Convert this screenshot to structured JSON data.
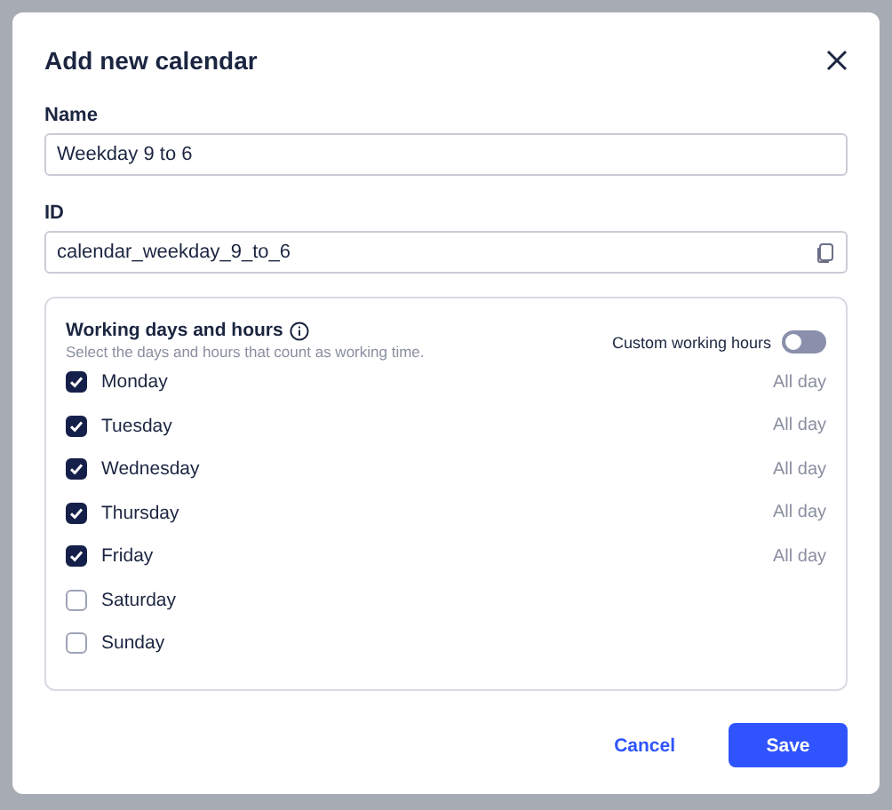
{
  "dialog": {
    "title": "Add new calendar"
  },
  "fields": [
    {
      "label": "Name",
      "value": "Weekday 9 to 6",
      "kind": "text"
    },
    {
      "label": "ID",
      "value": "calendar_weekday_9_to_6",
      "kind": "copy"
    }
  ],
  "working": {
    "title": "Working days and hours",
    "description": "Select the days and hours that count as working time.",
    "toggle_label": "Custom working hours",
    "toggle_on": false,
    "days": [
      {
        "name": "Monday",
        "checked": true,
        "hours": "All day"
      },
      {
        "name": "Tuesday",
        "checked": true,
        "hours": "All day"
      },
      {
        "name": "Wednesday",
        "checked": true,
        "hours": "All day"
      },
      {
        "name": "Thursday",
        "checked": true,
        "hours": "All day"
      },
      {
        "name": "Friday",
        "checked": true,
        "hours": "All day"
      },
      {
        "name": "Saturday",
        "checked": false
      },
      {
        "name": "Sunday",
        "checked": false
      }
    ]
  },
  "buttons": [
    {
      "label": "Cancel",
      "kind": "secondary"
    },
    {
      "label": "Save",
      "kind": "primary"
    }
  ]
}
